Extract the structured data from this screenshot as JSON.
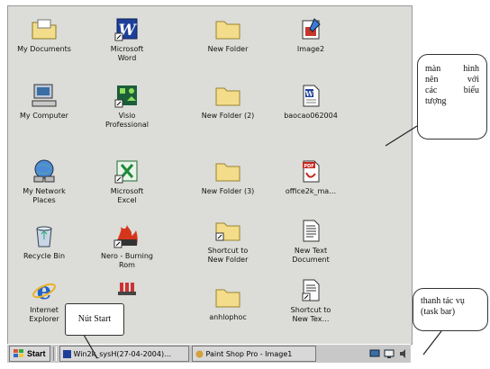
{
  "desktop": {
    "icons": [
      {
        "label": "My Documents",
        "icon": "folder-documents-icon"
      },
      {
        "label": "Microsoft\nWord",
        "icon": "word-icon"
      },
      {
        "label": "New Folder",
        "icon": "folder-icon"
      },
      {
        "label": "Image2",
        "icon": "paint-icon"
      },
      {
        "label": "My Computer",
        "icon": "computer-icon"
      },
      {
        "label": "Visio\nProfessional",
        "icon": "visio-icon"
      },
      {
        "label": "New Folder (2)",
        "icon": "folder-icon"
      },
      {
        "label": "baocao062004",
        "icon": "word-document-icon"
      },
      {
        "label": "My Network\nPlaces",
        "icon": "network-icon"
      },
      {
        "label": "Microsoft\nExcel",
        "icon": "excel-icon"
      },
      {
        "label": "New Folder (3)",
        "icon": "folder-icon"
      },
      {
        "label": "office2k_ma…",
        "icon": "pdf-icon"
      },
      {
        "label": "Recycle Bin",
        "icon": "recycle-bin-icon"
      },
      {
        "label": "Nero - Burning\nRom",
        "icon": "nero-icon"
      },
      {
        "label": "Shortcut to\nNew Folder",
        "icon": "folder-shortcut-icon"
      },
      {
        "label": "New Text\nDocument",
        "icon": "text-document-icon"
      },
      {
        "label": "Internet\nExplorer",
        "icon": "internet-explorer-icon"
      },
      {
        "label": "",
        "icon": "app-icon"
      },
      {
        "label": "anhlophoc",
        "icon": "folder-icon"
      },
      {
        "label": "Shortcut to\nNew Tex…",
        "icon": "text-shortcut-icon"
      }
    ]
  },
  "taskbar": {
    "start_label": "Start",
    "tasks": [
      {
        "label": "Win2k_sysH(27-04-2004)…"
      },
      {
        "label": "Paint Shop Pro - Image1"
      }
    ]
  },
  "callouts": {
    "desktop_note": [
      "màn hình",
      "nên với",
      "các biểu",
      "tượng"
    ],
    "start_note": "Nút Start",
    "taskbar_note": [
      "thanh tác vụ",
      "(task bar)"
    ]
  }
}
